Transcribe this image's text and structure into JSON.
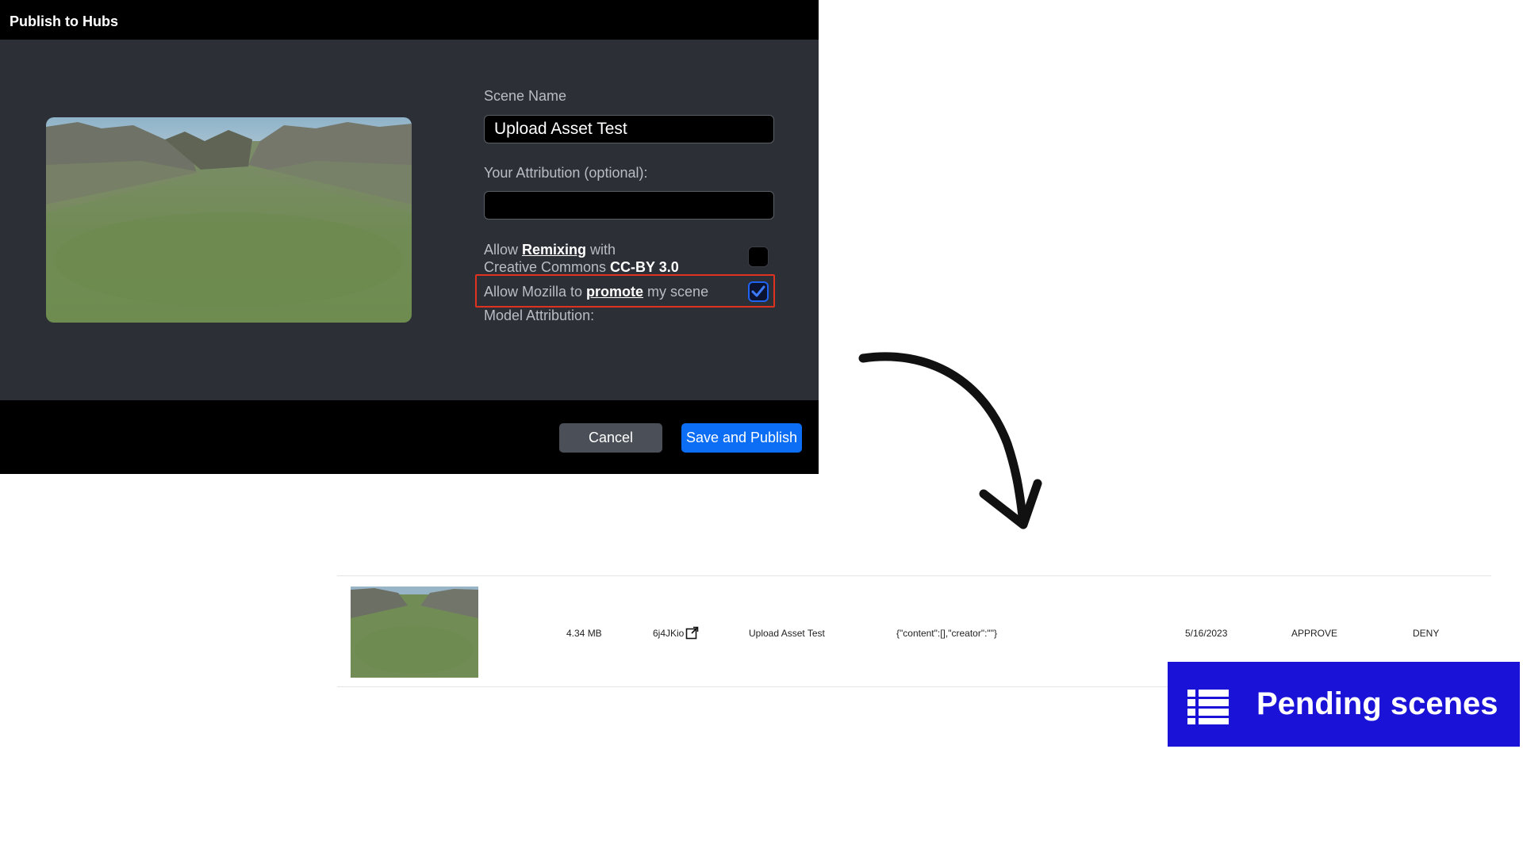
{
  "dialog": {
    "title": "Publish to Hubs",
    "scene_name_label": "Scene Name",
    "scene_name_value": "Upload Asset Test",
    "attribution_label": "Your Attribution (optional):",
    "attribution_value": "",
    "remix": {
      "prefix": "Allow ",
      "link": "Remixing",
      "suffix": " with",
      "line2_prefix": "Creative Commons ",
      "license": "CC-BY 3.0",
      "checked": false
    },
    "promote": {
      "prefix": "Allow Mozilla to ",
      "link": "promote",
      "suffix": " my scene",
      "checked": true
    },
    "model_attribution_label": "Model Attribution:",
    "cancel_label": "Cancel",
    "publish_label": "Save and Publish"
  },
  "pending_row": {
    "size": "4.34 MB",
    "id": "6j4JKio",
    "name": "Upload Asset Test",
    "attributions": "{\"content\":[],\"creator\":\"\"}",
    "date": "5/16/2023",
    "approve_label": "APPROVE",
    "deny_label": "DENY"
  },
  "badge": {
    "label": "Pending scenes",
    "icon": "list-icon",
    "color": "#1a12d6"
  },
  "colors": {
    "accent": "#0b6ef5",
    "highlight": "#e0331f",
    "dialog_bg": "#2c2f36"
  }
}
